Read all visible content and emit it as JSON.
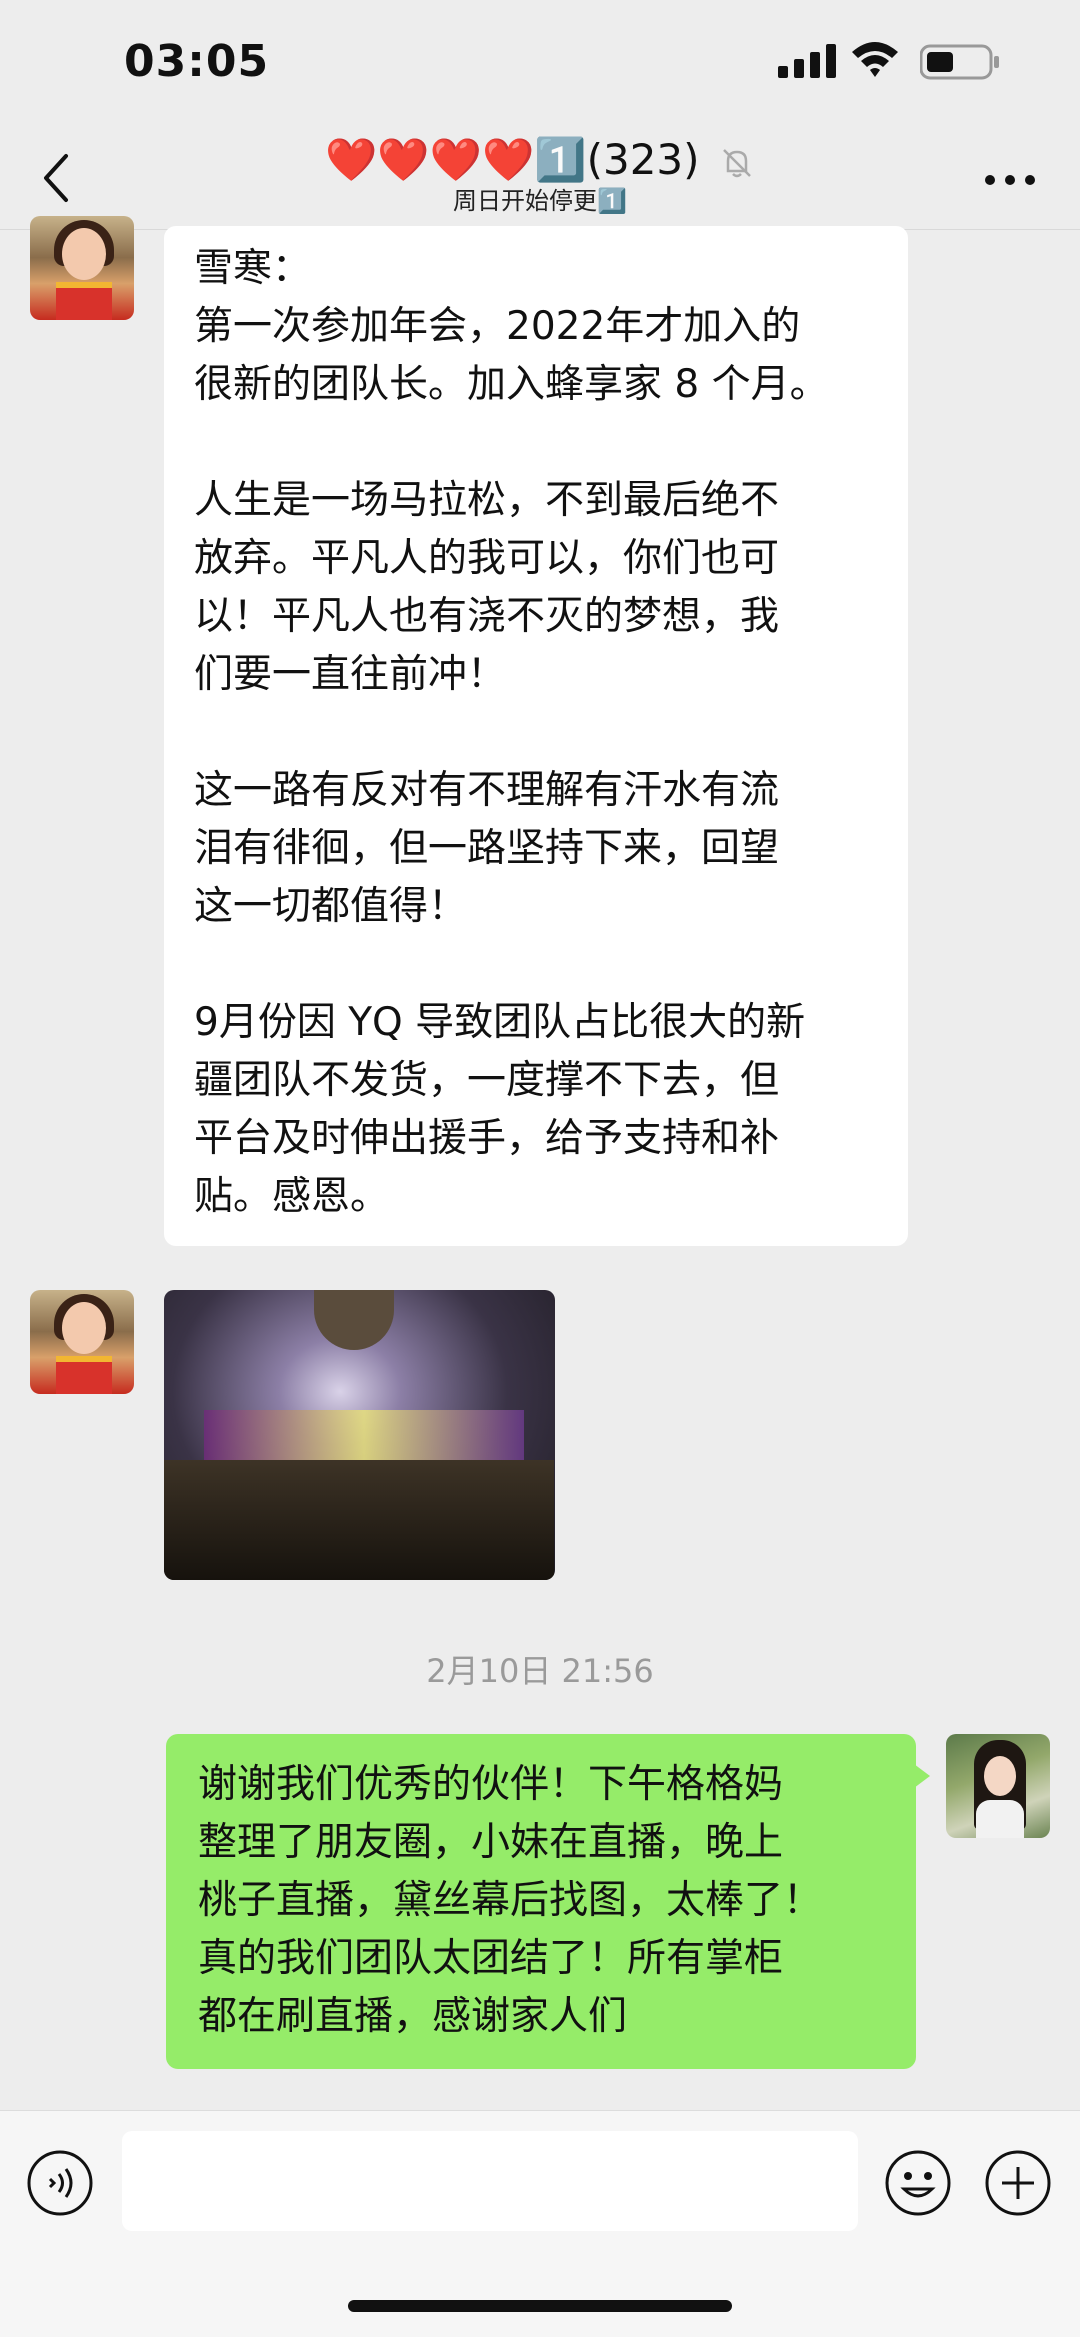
{
  "status_bar": {
    "time": "03:05"
  },
  "nav": {
    "title": "❤️❤️❤️❤️1️⃣(323)",
    "subtitle": "周日开始停更1️⃣"
  },
  "messages": [
    {
      "sender": "other",
      "type": "text",
      "text": "雪寒：\n第一次参加年会，2022年才加入的\n很新的团队长。加入蜂享家 8 个月。\n\n人生是一场马拉松，不到最后绝不\n放弃。平凡人的我可以，你们也可\n以！平凡人也有浇不灭的梦想，我\n们要一直往前冲！\n\n这一路有反对有不理解有汗水有流\n泪有徘徊，但一路坚持下来，回望\n这一切都值得！\n\n9月份因 YQ 导致团队占比很大的新\n疆团队不发货，一度撑不下去，但\n平台及时伸出援手，给予支持和补\n贴。感恩。"
    },
    {
      "sender": "other",
      "type": "image"
    },
    {
      "sender": "self",
      "type": "text",
      "text": "谢谢我们优秀的伙伴！下午格格妈\n整理了朋友圈，小妹在直播，晚上\n桃子直播，黛丝幕后找图，太棒了！\n真的我们团队太团结了！所有掌柜\n都在刷直播，感谢家人们"
    }
  ],
  "timestamp": "2月10日 21:56",
  "input": {
    "value": ""
  },
  "icons": {
    "back": "chevron-left-icon",
    "mute": "bell-slash-icon",
    "more": "more-dots-icon",
    "voice": "voice-icon",
    "emoji": "emoji-icon",
    "plus": "plus-icon"
  }
}
